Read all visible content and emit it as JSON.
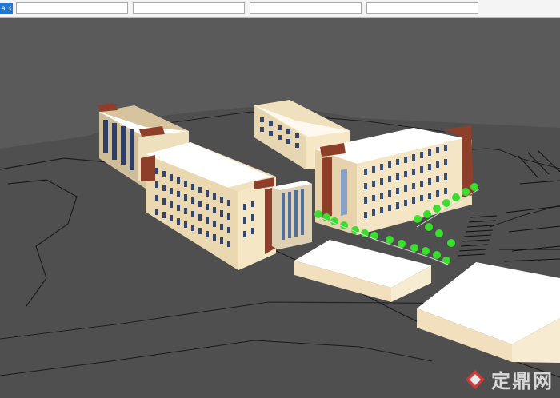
{
  "window": {
    "tab_label": "a 3"
  },
  "viewport": {
    "background": "#595959",
    "terrain_color": "#4d4d4d",
    "line_color": "#1a1a1a"
  },
  "scene": {
    "building_colors": {
      "wall": "#f4e7c3",
      "roof": "#ffffff",
      "window": "#3a4d78",
      "accent": "#8e3e26"
    },
    "tree_color": "#38df2d"
  },
  "watermark": {
    "text": "定鼎网",
    "icon": "dingding-logo-icon"
  }
}
